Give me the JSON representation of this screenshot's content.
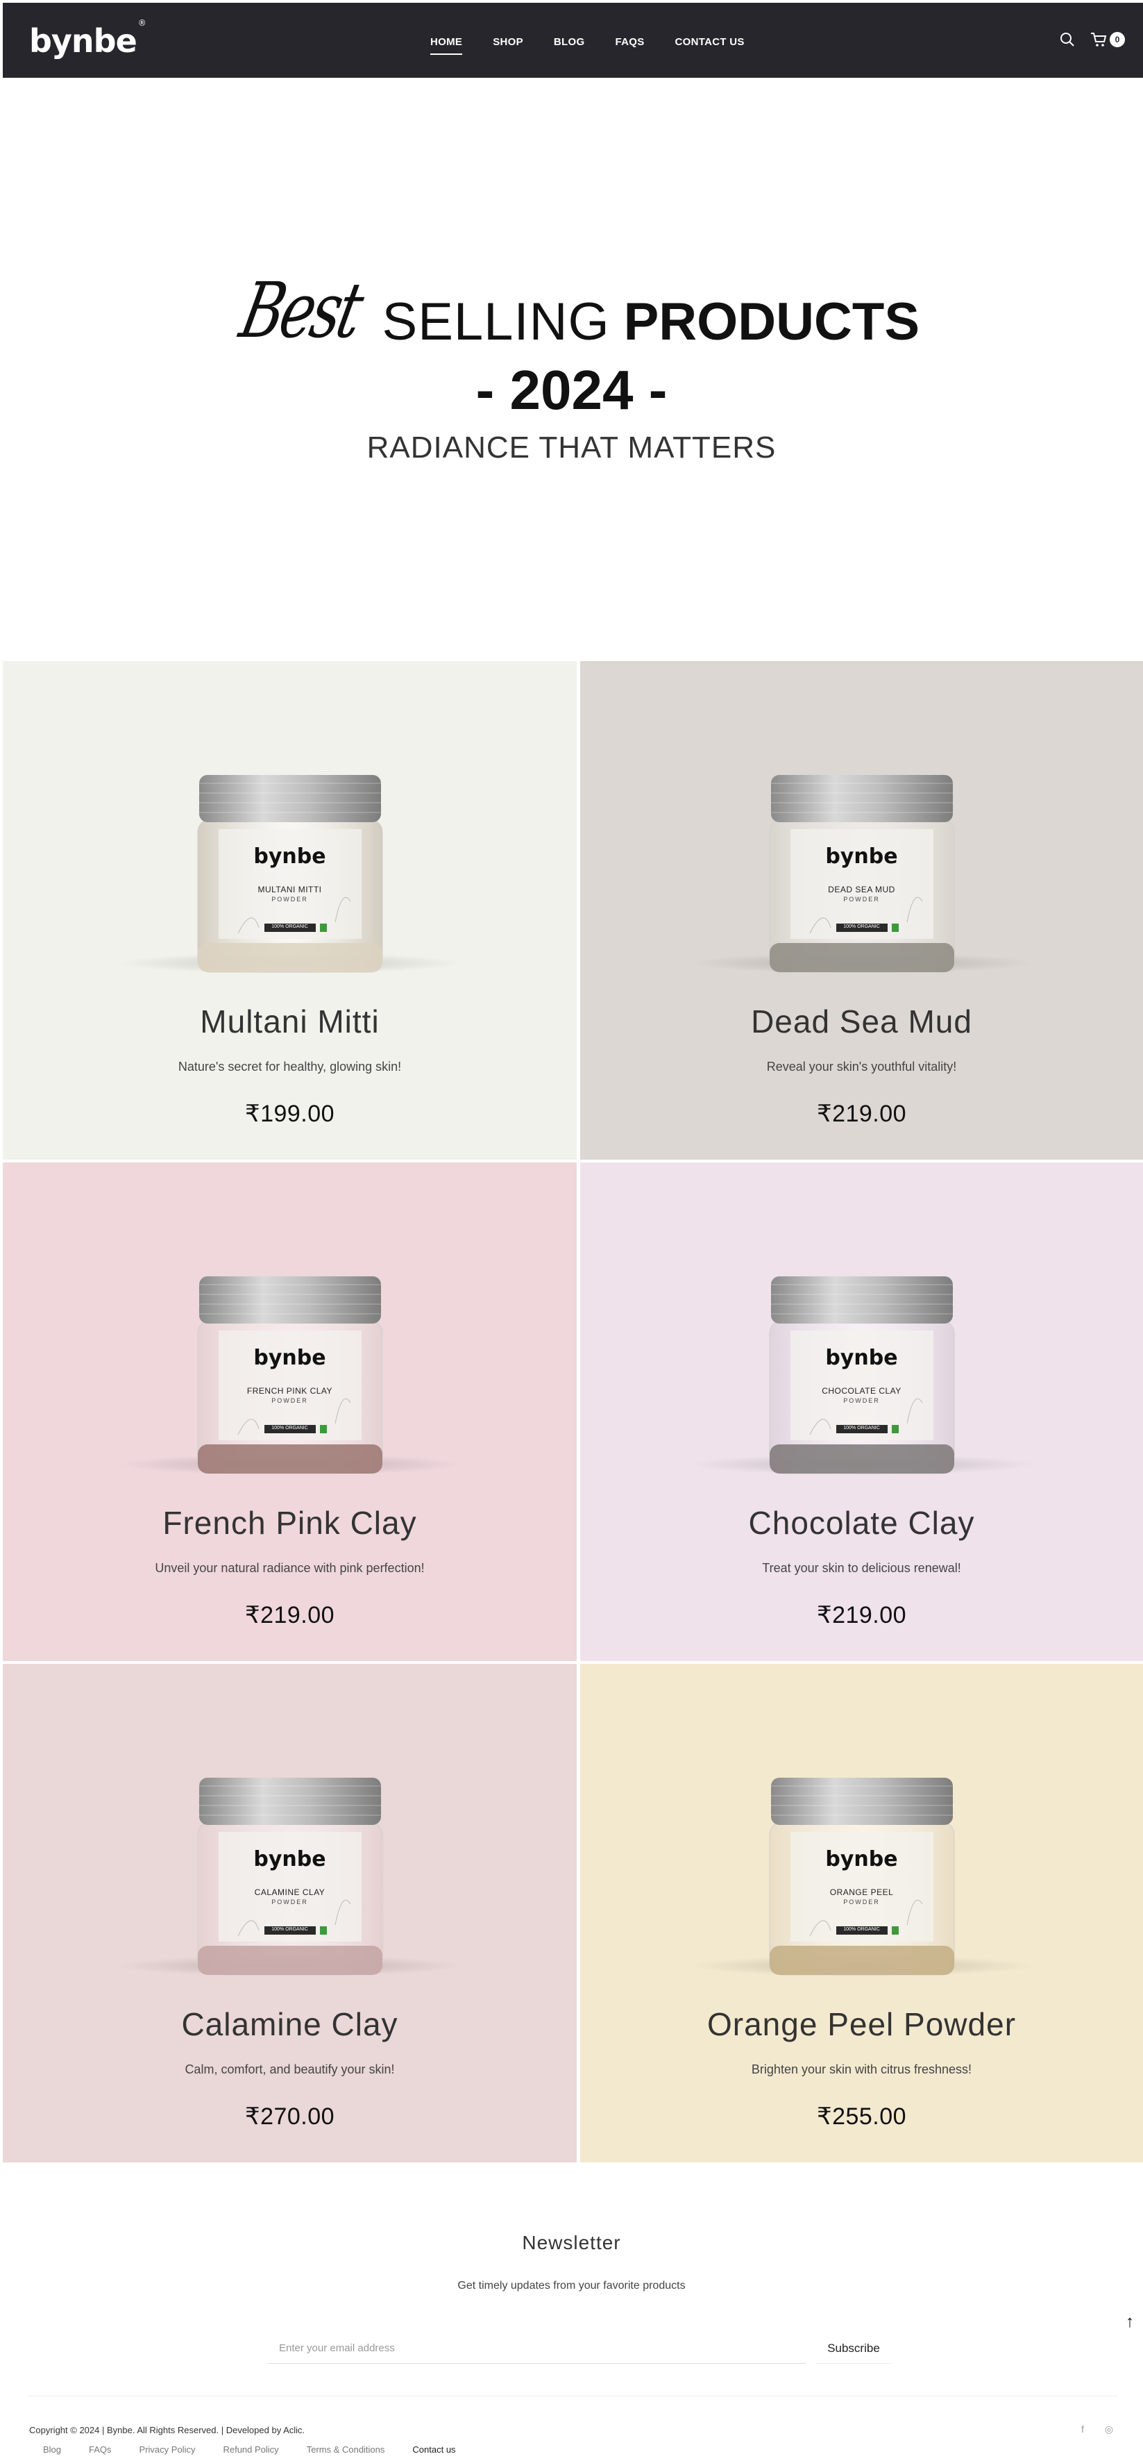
{
  "header": {
    "logo": "bynbe",
    "logo_mark": "®",
    "nav": [
      "HOME",
      "SHOP",
      "BLOG",
      "FAQS",
      "CONTACT US"
    ],
    "active_nav": "HOME",
    "cart_count": "0",
    "icons": [
      "search-icon",
      "cart-icon"
    ]
  },
  "hero": {
    "script_word": "Best",
    "word_selling": "SELLING",
    "word_products": "PRODUCTS",
    "year": "- 2024 -",
    "subtitle": "RADIANCE THAT MATTERS"
  },
  "products": [
    {
      "name": "Multani Mitti",
      "desc": "Nature's secret for healthy, glowing skin!",
      "price": "₹199.00",
      "bg": "#f1f2ec",
      "jar_label": "MULTANI MITTI",
      "jar_tone": "#cfc7b9",
      "jar_bottom": "#dcd2bf"
    },
    {
      "name": "Dead Sea Mud",
      "desc": "Reveal your skin's youthful vitality!",
      "price": "₹219.00",
      "bg": "#dcd7d3",
      "jar_label": "DEAD SEA MUD",
      "jar_tone": "#d8d4cc",
      "jar_bottom": "#8e8b82"
    },
    {
      "name": "French Pink Clay",
      "desc": "Unveil your natural radiance with pink perfection!",
      "price": "₹219.00",
      "bg": "#efd7dc",
      "jar_label": "FRENCH PINK CLAY",
      "jar_tone": "#e3cfd0",
      "jar_bottom": "#9b7570"
    },
    {
      "name": "Chocolate Clay",
      "desc": "Treat your skin to delicious renewal!",
      "price": "₹219.00",
      "bg": "#efe2ea",
      "jar_label": "CHOCOLATE CLAY",
      "jar_tone": "#ddd0dc",
      "jar_bottom": "#7c7878"
    },
    {
      "name": "Calamine Clay",
      "desc": "Calm, comfort, and beautify your skin!",
      "price": "₹270.00",
      "bg": "#ead7d7",
      "jar_label": "CALAMINE CLAY",
      "jar_tone": "#e5cfd0",
      "jar_bottom": "#c4a3a3"
    },
    {
      "name": "Orange Peel Powder",
      "desc": "Brighten your skin with citrus freshness!",
      "price": "₹255.00",
      "bg": "#f3e9cf",
      "jar_label": "ORANGE PEEL",
      "jar_tone": "#e8dcc2",
      "jar_bottom": "#c3ae84"
    }
  ],
  "jar_common": {
    "brand": "bynbe",
    "powder": "POWDER",
    "badge": "100% ORGANIC"
  },
  "newsletter": {
    "title": "Newsletter",
    "text": "Get timely updates from your favorite products",
    "placeholder": "Enter your email address",
    "button": "Subscribe",
    "to_top": "↑"
  },
  "footer": {
    "copyright": "Copyright © 2024 | Bynbe. All Rights Reserved. | Developed by Aclic.",
    "links": [
      "Blog",
      "FAQs",
      "Privacy Policy",
      "Refund Policy",
      "Terms & Conditions",
      "Contact us"
    ],
    "social": [
      "f",
      "◎"
    ]
  }
}
